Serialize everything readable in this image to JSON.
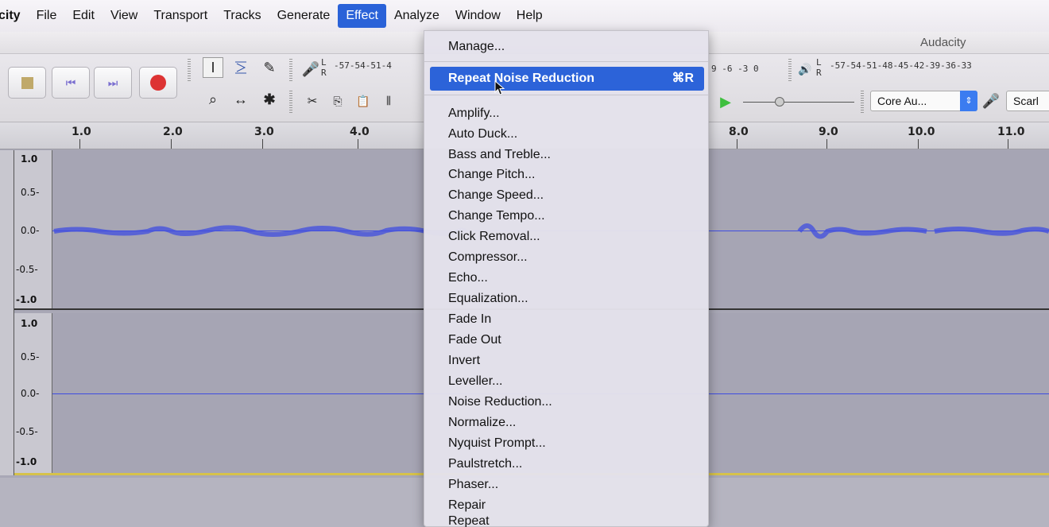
{
  "menubar": {
    "app": "city",
    "items": [
      "File",
      "Edit",
      "View",
      "Transport",
      "Tracks",
      "Generate",
      "Effect",
      "Analyze",
      "Window",
      "Help"
    ]
  },
  "window": {
    "title": "Audacity"
  },
  "toolbar": {
    "meter_record_ticks": "-57-54-51-4",
    "meter_record_end": "9 -6 -3 0",
    "meter_play_ticks": "-57-54-51-48-45-42-39-36-33",
    "channel_l": "L",
    "channel_r": "R",
    "device_host": "Core Au...",
    "device_output": "Scarl"
  },
  "ruler": {
    "labels": [
      "1.0",
      "2.0",
      "3.0",
      "4.0",
      "8.0",
      "9.0",
      "10.0",
      "11.0"
    ]
  },
  "tracks": {
    "track1_scale": [
      "1.0",
      "0.5-",
      "0.0-",
      "-0.5-",
      "-1.0"
    ],
    "track2_scale": [
      "1.0",
      "0.5-",
      "0.0-",
      "-0.5-",
      "-1.0"
    ]
  },
  "effect_menu": {
    "manage": "Manage...",
    "repeat_label": "Repeat Noise Reduction",
    "repeat_shortcut": "⌘R",
    "items": [
      "Amplify...",
      "Auto Duck...",
      "Bass and Treble...",
      "Change Pitch...",
      "Change Speed...",
      "Change Tempo...",
      "Click Removal...",
      "Compressor...",
      "Echo...",
      "Equalization...",
      "Fade In",
      "Fade Out",
      "Invert",
      "Leveller...",
      "Noise Reduction...",
      "Normalize...",
      "Nyquist Prompt...",
      "Paulstretch...",
      "Phaser...",
      "Repair",
      "Repeat"
    ]
  },
  "colors": {
    "accent": "#2c63d9",
    "waveform": "#3f4de0",
    "track_bg": "#a6a5b4"
  }
}
